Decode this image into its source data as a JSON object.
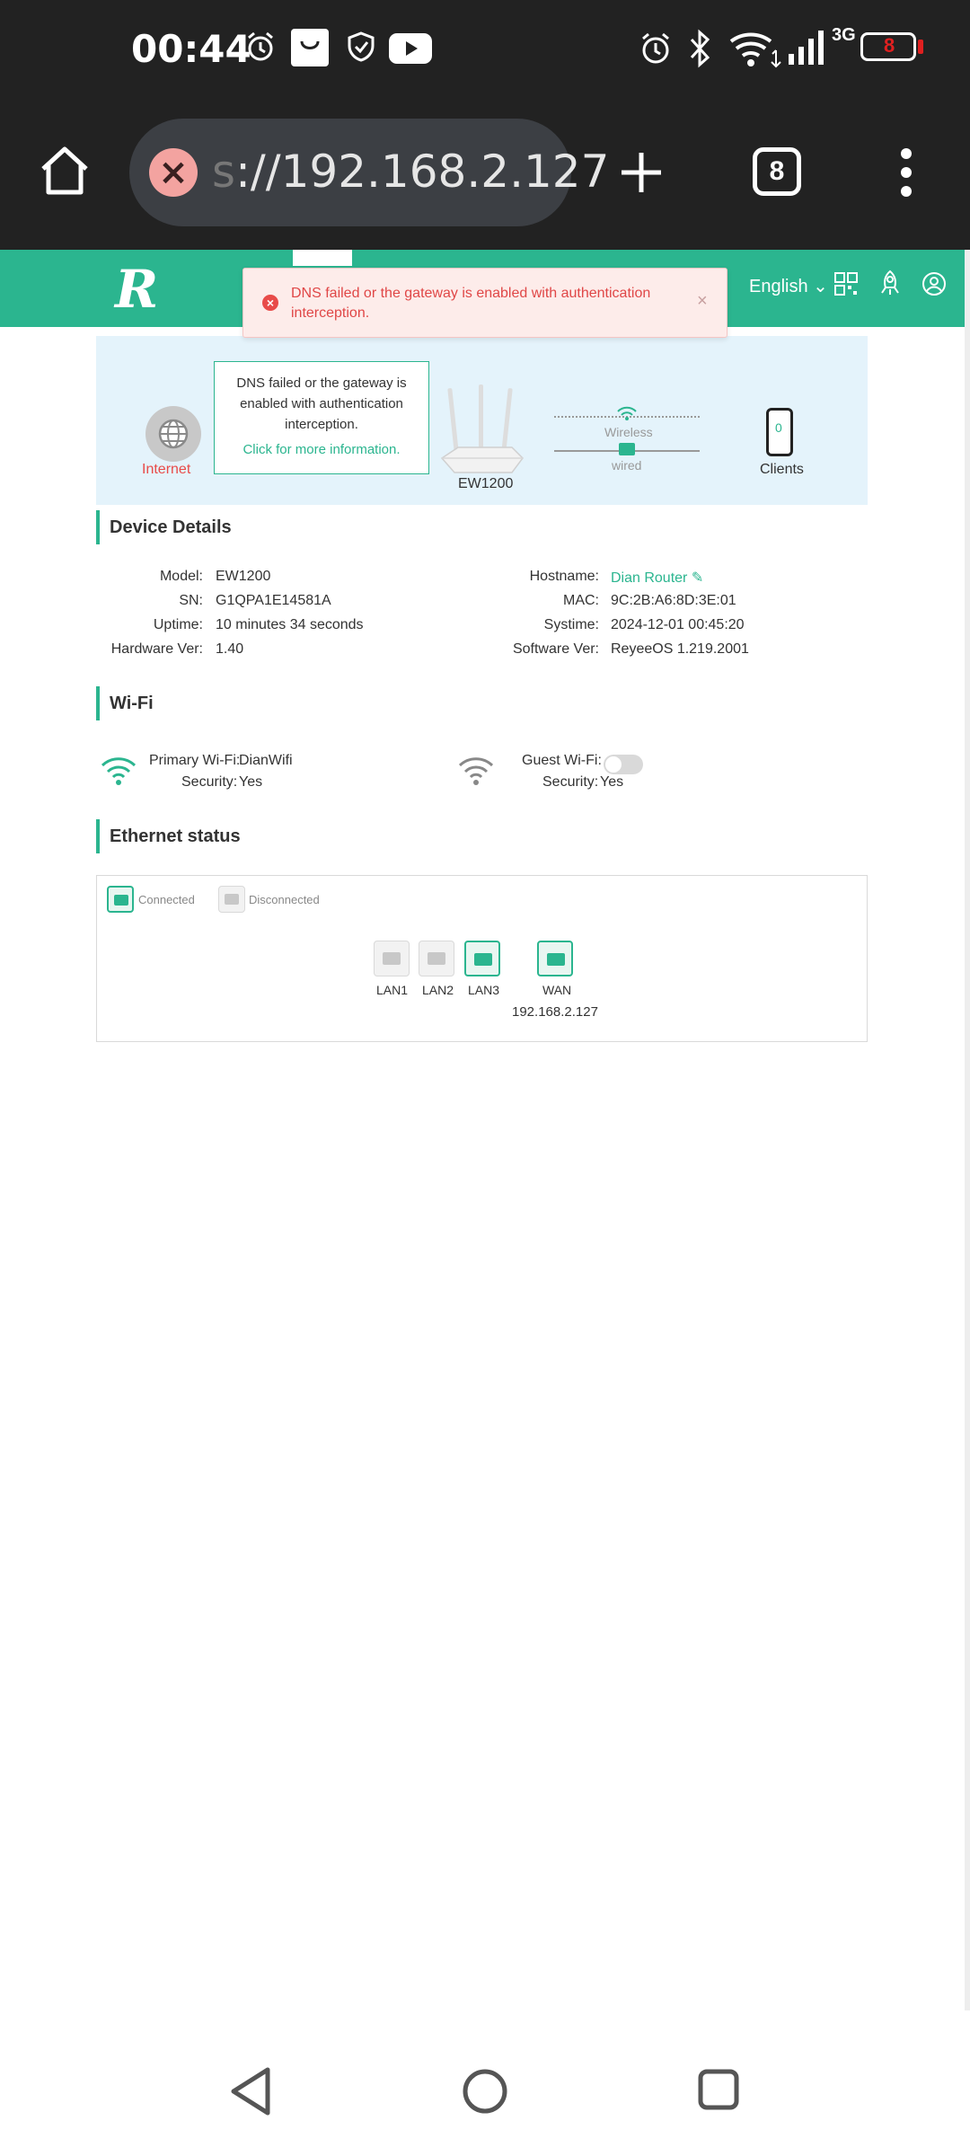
{
  "status_bar": {
    "time": "00:44",
    "network": "3G",
    "battery": "8"
  },
  "browser": {
    "url_scheme_fragment": "s",
    "url": "://192.168.2.127",
    "tab_count": "8"
  },
  "header": {
    "logo": "R",
    "language": "English"
  },
  "toast": {
    "message": "DNS failed or the gateway is enabled with authentication interception."
  },
  "topology": {
    "internet_label": "Internet",
    "info_text": "DNS failed or the gateway is enabled with authentication interception.",
    "info_link": "Click for more information.",
    "router_model": "EW1200",
    "wireless_label": "Wireless",
    "wired_label": "wired",
    "clients_count": "0",
    "clients_label": "Clients"
  },
  "device_details": {
    "title": "Device Details",
    "left": [
      {
        "label": "Model:",
        "value": "EW1200"
      },
      {
        "label": "SN:",
        "value": "G1QPA1E14581A"
      },
      {
        "label": "Uptime:",
        "value": "10 minutes 34 seconds"
      },
      {
        "label": "Hardware Ver:",
        "value": "1.40"
      }
    ],
    "right": [
      {
        "label": "Hostname:",
        "value": "Dian Router"
      },
      {
        "label": "MAC:",
        "value": "9C:2B:A6:8D:3E:01"
      },
      {
        "label": "Systime:",
        "value": "2024-12-01 00:45:20"
      },
      {
        "label": "Software Ver:",
        "value": "ReyeeOS 1.219.2001"
      }
    ]
  },
  "wifi": {
    "title": "Wi-Fi",
    "primary_label": "Primary Wi-Fi:",
    "primary_ssid": "DianWifi",
    "primary_security_label": "Security:",
    "primary_security": "Yes",
    "guest_label": "Guest Wi-Fi:",
    "guest_enabled": false,
    "guest_security_label": "Security:",
    "guest_security": "Yes"
  },
  "ethernet": {
    "title": "Ethernet status",
    "legend_connected": "Connected",
    "legend_disconnected": "Disconnected",
    "ports": [
      {
        "name": "LAN1",
        "connected": false
      },
      {
        "name": "LAN2",
        "connected": false
      },
      {
        "name": "LAN3",
        "connected": true
      },
      {
        "name": "WAN",
        "connected": true
      }
    ],
    "wan_ip": "192.168.2.127"
  },
  "colors": {
    "accent": "#2bb58f",
    "error": "#e84b49",
    "panel_bg": "#e4f3fb"
  }
}
